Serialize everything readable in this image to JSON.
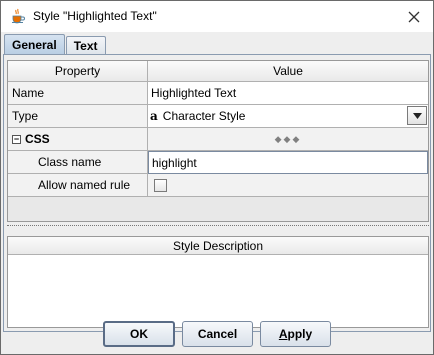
{
  "window": {
    "title": "Style \"Highlighted Text\""
  },
  "tabs": [
    {
      "label": "General",
      "active": true
    },
    {
      "label": "Text",
      "active": false
    }
  ],
  "table": {
    "headers": {
      "property": "Property",
      "value": "Value"
    },
    "rows": {
      "name": {
        "label": "Name",
        "value": "Highlighted Text"
      },
      "type": {
        "label": "Type",
        "icon": "a",
        "value": "Character Style"
      },
      "css": {
        "label": "CSS",
        "expanded": true,
        "expand_symbol": "−",
        "value_glyph": "◆◆◆"
      },
      "class_name": {
        "label": "Class name",
        "value": "highlight"
      },
      "allow_named_rule": {
        "label": "Allow named rule",
        "checked": false
      }
    }
  },
  "description": {
    "header": "Style Description",
    "value": ""
  },
  "buttons": {
    "ok": "OK",
    "cancel": "Cancel",
    "apply_prefix": "",
    "apply_mnemonic": "A",
    "apply_rest": "pply"
  },
  "icons": {
    "app": "java-cup-icon",
    "close": "close-icon",
    "dropdown": "chevron-down-icon"
  },
  "colors": {
    "tab_active": "#b8cde3",
    "panel_bg": "#eeeeee",
    "border": "#8a9bb0"
  }
}
